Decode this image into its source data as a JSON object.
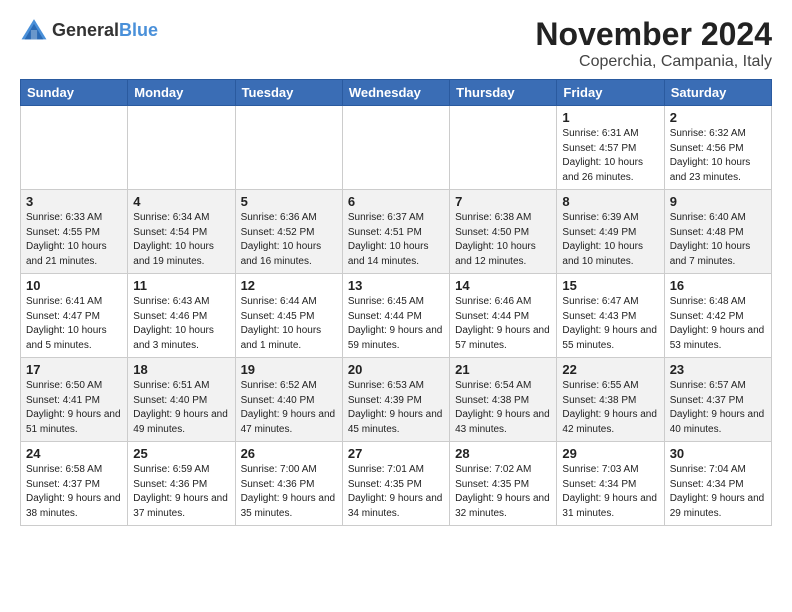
{
  "logo": {
    "general": "General",
    "blue": "Blue"
  },
  "title": "November 2024",
  "subtitle": "Coperchia, Campania, Italy",
  "days_of_week": [
    "Sunday",
    "Monday",
    "Tuesday",
    "Wednesday",
    "Thursday",
    "Friday",
    "Saturday"
  ],
  "weeks": [
    [
      {
        "day": "",
        "info": ""
      },
      {
        "day": "",
        "info": ""
      },
      {
        "day": "",
        "info": ""
      },
      {
        "day": "",
        "info": ""
      },
      {
        "day": "",
        "info": ""
      },
      {
        "day": "1",
        "info": "Sunrise: 6:31 AM\nSunset: 4:57 PM\nDaylight: 10 hours and 26 minutes."
      },
      {
        "day": "2",
        "info": "Sunrise: 6:32 AM\nSunset: 4:56 PM\nDaylight: 10 hours and 23 minutes."
      }
    ],
    [
      {
        "day": "3",
        "info": "Sunrise: 6:33 AM\nSunset: 4:55 PM\nDaylight: 10 hours and 21 minutes."
      },
      {
        "day": "4",
        "info": "Sunrise: 6:34 AM\nSunset: 4:54 PM\nDaylight: 10 hours and 19 minutes."
      },
      {
        "day": "5",
        "info": "Sunrise: 6:36 AM\nSunset: 4:52 PM\nDaylight: 10 hours and 16 minutes."
      },
      {
        "day": "6",
        "info": "Sunrise: 6:37 AM\nSunset: 4:51 PM\nDaylight: 10 hours and 14 minutes."
      },
      {
        "day": "7",
        "info": "Sunrise: 6:38 AM\nSunset: 4:50 PM\nDaylight: 10 hours and 12 minutes."
      },
      {
        "day": "8",
        "info": "Sunrise: 6:39 AM\nSunset: 4:49 PM\nDaylight: 10 hours and 10 minutes."
      },
      {
        "day": "9",
        "info": "Sunrise: 6:40 AM\nSunset: 4:48 PM\nDaylight: 10 hours and 7 minutes."
      }
    ],
    [
      {
        "day": "10",
        "info": "Sunrise: 6:41 AM\nSunset: 4:47 PM\nDaylight: 10 hours and 5 minutes."
      },
      {
        "day": "11",
        "info": "Sunrise: 6:43 AM\nSunset: 4:46 PM\nDaylight: 10 hours and 3 minutes."
      },
      {
        "day": "12",
        "info": "Sunrise: 6:44 AM\nSunset: 4:45 PM\nDaylight: 10 hours and 1 minute."
      },
      {
        "day": "13",
        "info": "Sunrise: 6:45 AM\nSunset: 4:44 PM\nDaylight: 9 hours and 59 minutes."
      },
      {
        "day": "14",
        "info": "Sunrise: 6:46 AM\nSunset: 4:44 PM\nDaylight: 9 hours and 57 minutes."
      },
      {
        "day": "15",
        "info": "Sunrise: 6:47 AM\nSunset: 4:43 PM\nDaylight: 9 hours and 55 minutes."
      },
      {
        "day": "16",
        "info": "Sunrise: 6:48 AM\nSunset: 4:42 PM\nDaylight: 9 hours and 53 minutes."
      }
    ],
    [
      {
        "day": "17",
        "info": "Sunrise: 6:50 AM\nSunset: 4:41 PM\nDaylight: 9 hours and 51 minutes."
      },
      {
        "day": "18",
        "info": "Sunrise: 6:51 AM\nSunset: 4:40 PM\nDaylight: 9 hours and 49 minutes."
      },
      {
        "day": "19",
        "info": "Sunrise: 6:52 AM\nSunset: 4:40 PM\nDaylight: 9 hours and 47 minutes."
      },
      {
        "day": "20",
        "info": "Sunrise: 6:53 AM\nSunset: 4:39 PM\nDaylight: 9 hours and 45 minutes."
      },
      {
        "day": "21",
        "info": "Sunrise: 6:54 AM\nSunset: 4:38 PM\nDaylight: 9 hours and 43 minutes."
      },
      {
        "day": "22",
        "info": "Sunrise: 6:55 AM\nSunset: 4:38 PM\nDaylight: 9 hours and 42 minutes."
      },
      {
        "day": "23",
        "info": "Sunrise: 6:57 AM\nSunset: 4:37 PM\nDaylight: 9 hours and 40 minutes."
      }
    ],
    [
      {
        "day": "24",
        "info": "Sunrise: 6:58 AM\nSunset: 4:37 PM\nDaylight: 9 hours and 38 minutes."
      },
      {
        "day": "25",
        "info": "Sunrise: 6:59 AM\nSunset: 4:36 PM\nDaylight: 9 hours and 37 minutes."
      },
      {
        "day": "26",
        "info": "Sunrise: 7:00 AM\nSunset: 4:36 PM\nDaylight: 9 hours and 35 minutes."
      },
      {
        "day": "27",
        "info": "Sunrise: 7:01 AM\nSunset: 4:35 PM\nDaylight: 9 hours and 34 minutes."
      },
      {
        "day": "28",
        "info": "Sunrise: 7:02 AM\nSunset: 4:35 PM\nDaylight: 9 hours and 32 minutes."
      },
      {
        "day": "29",
        "info": "Sunrise: 7:03 AM\nSunset: 4:34 PM\nDaylight: 9 hours and 31 minutes."
      },
      {
        "day": "30",
        "info": "Sunrise: 7:04 AM\nSunset: 4:34 PM\nDaylight: 9 hours and 29 minutes."
      }
    ]
  ]
}
